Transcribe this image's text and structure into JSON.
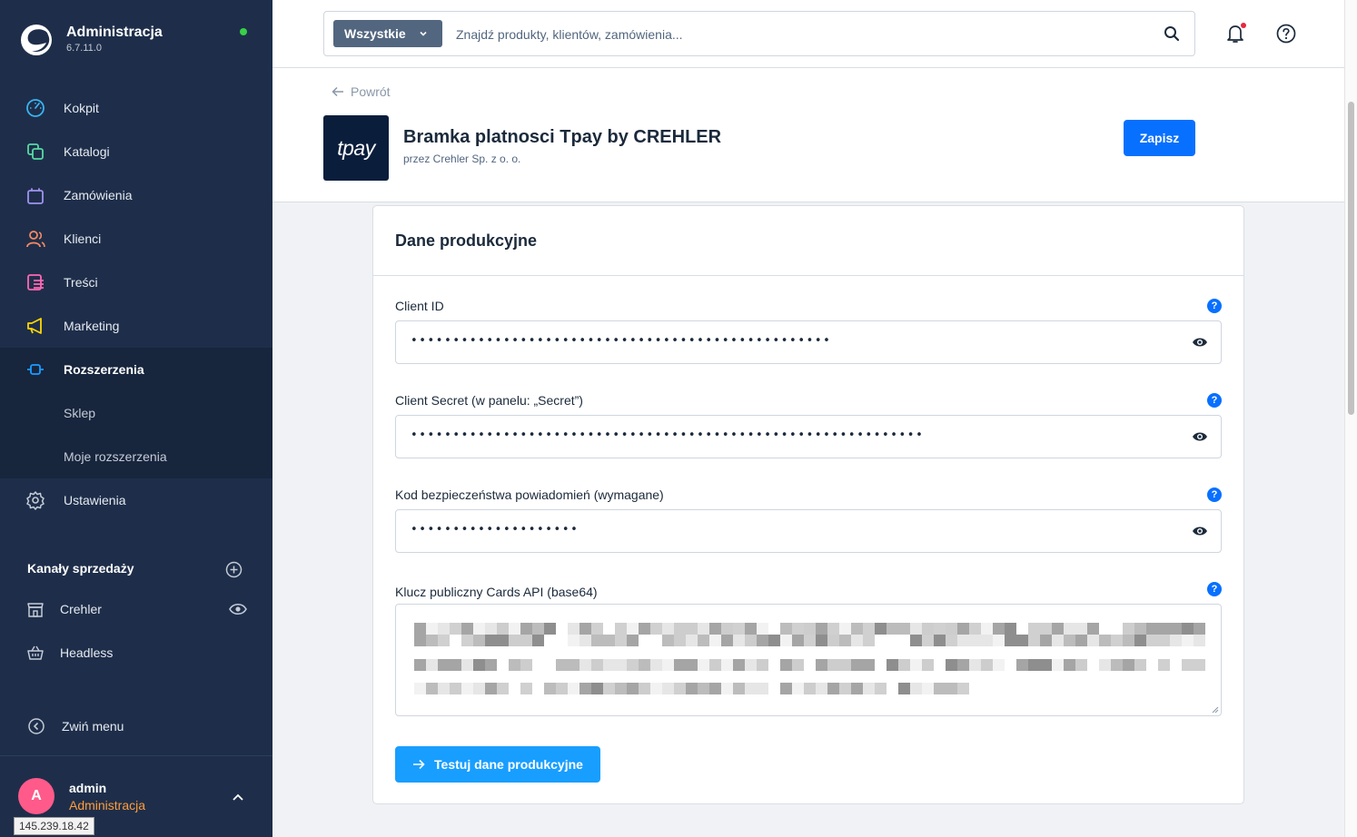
{
  "app": {
    "title": "Administracja",
    "version": "6.7.11.0",
    "status_color": "#37d046"
  },
  "nav": {
    "items": [
      {
        "label": "Kokpit",
        "icon": "gauge-icon",
        "color": "#3ab4f2"
      },
      {
        "label": "Katalogi",
        "icon": "catalog-icon",
        "color": "#57d9a3"
      },
      {
        "label": "Zamówienia",
        "icon": "bag-icon",
        "color": "#a092f0"
      },
      {
        "label": "Klienci",
        "icon": "users-icon",
        "color": "#f88962"
      },
      {
        "label": "Treści",
        "icon": "content-icon",
        "color": "#ff68b4"
      },
      {
        "label": "Marketing",
        "icon": "megaphone-icon",
        "color": "#ffd700"
      },
      {
        "label": "Rozszerzenia",
        "icon": "plug-icon",
        "color": "#189eff"
      }
    ],
    "sub_items": [
      {
        "label": "Sklep"
      },
      {
        "label": "Moje rozszerzenia"
      }
    ],
    "settings": {
      "label": "Ustawienia",
      "icon": "gear-icon"
    }
  },
  "channels": {
    "title": "Kanały sprzedaży",
    "items": [
      {
        "label": "Crehler",
        "icon": "storefront-icon"
      },
      {
        "label": "Headless",
        "icon": "basket-icon"
      }
    ]
  },
  "collapse_label": "Zwiń menu",
  "user": {
    "initial": "A",
    "name": "admin",
    "role": "Administracja"
  },
  "tooltip_ip": "145.239.18.42",
  "search": {
    "type_label": "Wszystkie",
    "placeholder": "Znajdź produkty, klientów, zamówienia..."
  },
  "header": {
    "back_label": "Powrót",
    "plugin_logo_text": "tpay",
    "plugin_title": "Bramka platnosci Tpay by CREHLER",
    "plugin_author": "przez Crehler Sp. z o. o.",
    "save_label": "Zapisz"
  },
  "card": {
    "title": "Dane produkcyjne",
    "fields": [
      {
        "label": "Client ID",
        "value": "••••••••••••••••••••••••••••••••••••••••••••••••••"
      },
      {
        "label": "Client Secret (w panelu: „Secret”)",
        "value": "•••••••••••••••••••••••••••••••••••••••••••••••••••••••••••••"
      },
      {
        "label": "Kod bezpieczeństwa powiadomień (wymagane)",
        "value": "••••••••••••••••••••"
      }
    ],
    "public_key_label": "Klucz publiczny Cards API (base64)",
    "help_glyph": "?",
    "test_label": "Testuj dane produkcyjne"
  },
  "colors": {
    "primary": "#0870ff",
    "test_button": "#189eff",
    "sidebar": "#1e2e4a",
    "user_role": "#ff9c3a",
    "avatar": "#ff5a8a"
  }
}
